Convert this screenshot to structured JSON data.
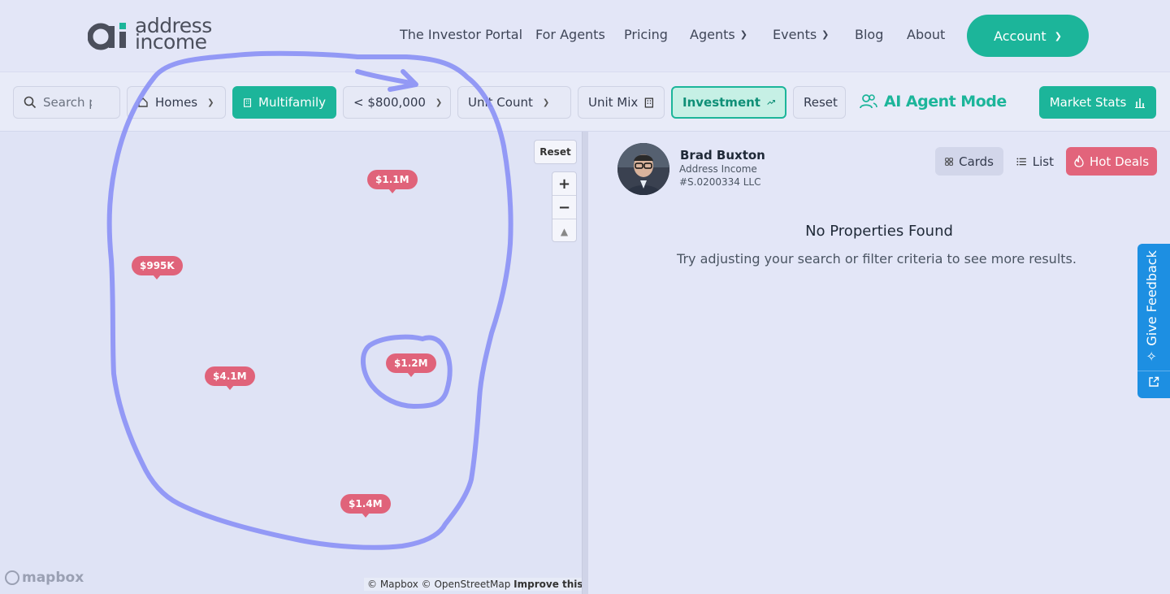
{
  "brand": {
    "logo_line1": "address",
    "logo_line2": "income",
    "colors": {
      "accent": "#1cb59a",
      "hot": "#e0637a",
      "feedback": "#1d8fe2",
      "annotation": "#8c93f5"
    }
  },
  "nav": {
    "items": [
      {
        "label": "The Investor Portal"
      },
      {
        "label": "For Agents"
      },
      {
        "label": "Pricing"
      },
      {
        "label": "Agents"
      },
      {
        "label": "Events"
      },
      {
        "label": "Blog"
      },
      {
        "label": "About"
      }
    ],
    "account_label": "Account"
  },
  "filters": {
    "search_placeholder": "Search p",
    "homes": "Homes",
    "multifamily": "Multifamily",
    "price": "< $800,000",
    "unit_count": "Unit Count",
    "unit_mix": "Unit Mix",
    "investment": "Investment",
    "reset": "Reset",
    "ai_mode": "AI Agent Mode",
    "market_stats": "Market Stats"
  },
  "map": {
    "reset_label": "Reset",
    "zoom_in": "+",
    "zoom_out": "−",
    "compass": "▲",
    "pins": [
      {
        "label": "$1.1M"
      },
      {
        "label": "$995K"
      },
      {
        "label": "$1.2M"
      },
      {
        "label": "$4.1M"
      },
      {
        "label": "$1.4M"
      }
    ],
    "logo": "mapbox",
    "attribution_1": "© Mapbox",
    "attribution_2": "© OpenStreetMap",
    "attribution_3": "Improve this map"
  },
  "agent": {
    "name": "Brad Buxton",
    "company": "Address Income",
    "id": "#S.0200334 LLC"
  },
  "views": {
    "cards": "Cards",
    "list": "List",
    "hot_deals": "Hot Deals"
  },
  "results": {
    "empty_title": "No Properties Found",
    "empty_subtitle": "Try adjusting your search or filter criteria to see more results."
  },
  "feedback": {
    "label": "Give Feedback"
  }
}
